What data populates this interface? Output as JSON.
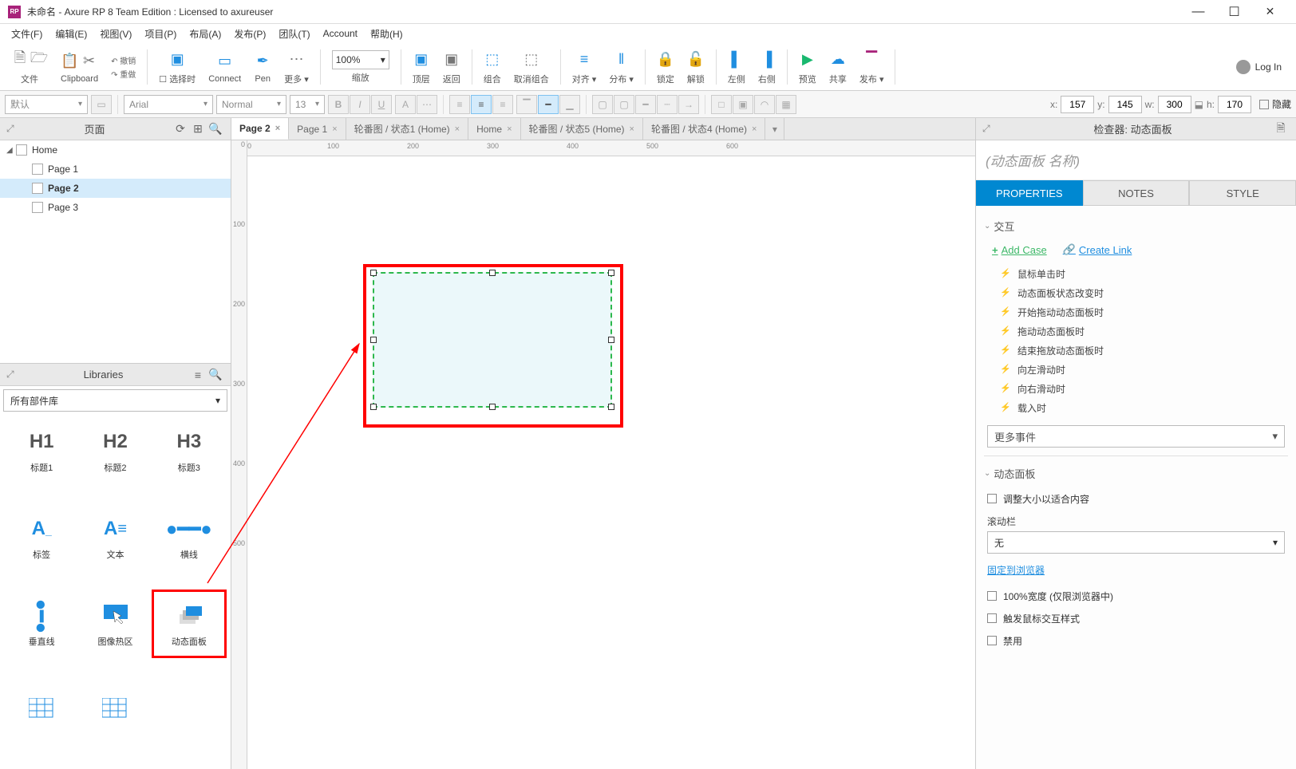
{
  "window": {
    "title": "未命名 - Axure RP 8 Team Edition : Licensed to axureuser",
    "logo_text": "RP"
  },
  "menu": {
    "file": "文件(F)",
    "edit": "编辑(E)",
    "view": "视图(V)",
    "project": "项目(P)",
    "arrange": "布局(A)",
    "publish": "发布(P)",
    "team": "团队(T)",
    "account": "Account",
    "help": "帮助(H)"
  },
  "toolbar": {
    "file": "文件",
    "clipboard": "Clipboard",
    "undo": "撤销",
    "redo": "重做",
    "select": "选择时",
    "connect": "Connect",
    "pen": "Pen",
    "more": "更多",
    "zoom_pct": "100%",
    "zoom_label": "缩放",
    "front": "顶层",
    "back": "返回",
    "group": "组合",
    "ungroup": "取消组合",
    "align": "对齐",
    "distribute": "分布",
    "lock": "锁定",
    "unlock": "解锁",
    "left": "左侧",
    "right": "右侧",
    "preview": "预览",
    "share": "共享",
    "publish": "发布",
    "login": "Log In"
  },
  "formatbar": {
    "widget_style": "默认",
    "font": "Arial",
    "weight": "Normal",
    "size": "13",
    "coords": {
      "x_label": "x:",
      "x": "157",
      "y_label": "y:",
      "y": "145",
      "w_label": "w:",
      "w": "300",
      "h_label": "h:",
      "h": "170"
    },
    "hidden_label": "隐藏"
  },
  "pages_pane": {
    "title": "页面",
    "items": [
      {
        "label": "Home",
        "indent": 0,
        "expanded": true
      },
      {
        "label": "Page 1",
        "indent": 1
      },
      {
        "label": "Page 2",
        "indent": 1,
        "selected": true
      },
      {
        "label": "Page 3",
        "indent": 1
      }
    ]
  },
  "libraries_pane": {
    "title": "Libraries",
    "selector": "所有部件库",
    "widgets": [
      {
        "icon": "H1",
        "label": "标题1",
        "type": "text"
      },
      {
        "icon": "H2",
        "label": "标题2",
        "type": "text"
      },
      {
        "icon": "H3",
        "label": "标题3",
        "type": "text"
      },
      {
        "icon": "A_",
        "label": "标签",
        "type": "label-blue"
      },
      {
        "icon": "A≡",
        "label": "文本",
        "type": "para-blue"
      },
      {
        "icon": "━",
        "label": "横线",
        "type": "hline-blue"
      },
      {
        "icon": "│",
        "label": "垂直线",
        "type": "vline-blue"
      },
      {
        "icon": "hot",
        "label": "图像热区",
        "type": "hotspot"
      },
      {
        "icon": "dyn",
        "label": "动态面板",
        "type": "dynamic",
        "highlight": true
      }
    ]
  },
  "tabs": [
    {
      "label": "Page 2",
      "active": true
    },
    {
      "label": "Page 1"
    },
    {
      "label": "轮番图 / 状态1 (Home)"
    },
    {
      "label": "Home"
    },
    {
      "label": "轮番图 / 状态5 (Home)"
    },
    {
      "label": "轮番图 / 状态4 (Home)"
    }
  ],
  "ruler": {
    "h": [
      "0",
      "100",
      "200",
      "300",
      "400",
      "500",
      "600"
    ],
    "v": [
      "0",
      "100",
      "200",
      "300",
      "400",
      "500"
    ]
  },
  "inspector": {
    "header": "检查器: 动态面板",
    "name_placeholder": "(动态面板 名称)",
    "tabs": {
      "props": "PROPERTIES",
      "notes": "NOTES",
      "style": "STYLE"
    },
    "interactions_title": "交互",
    "add_case": "Add Case",
    "create_link": "Create Link",
    "events": [
      "鼠标单击时",
      "动态面板状态改变时",
      "开始拖动动态面板时",
      "拖动动态面板时",
      "结束拖放动态面板时",
      "向左滑动时",
      "向右滑动时",
      "载入时"
    ],
    "more_events": "更多事件",
    "dp_title": "动态面板",
    "fit": "调整大小以适合内容",
    "scroll_label": "滚动栏",
    "scroll_value": "无",
    "pin": "固定到浏览器",
    "full_width": "100%宽度 (仅限浏览器中)",
    "trigger": "触发鼠标交互样式",
    "disable": "禁用"
  }
}
